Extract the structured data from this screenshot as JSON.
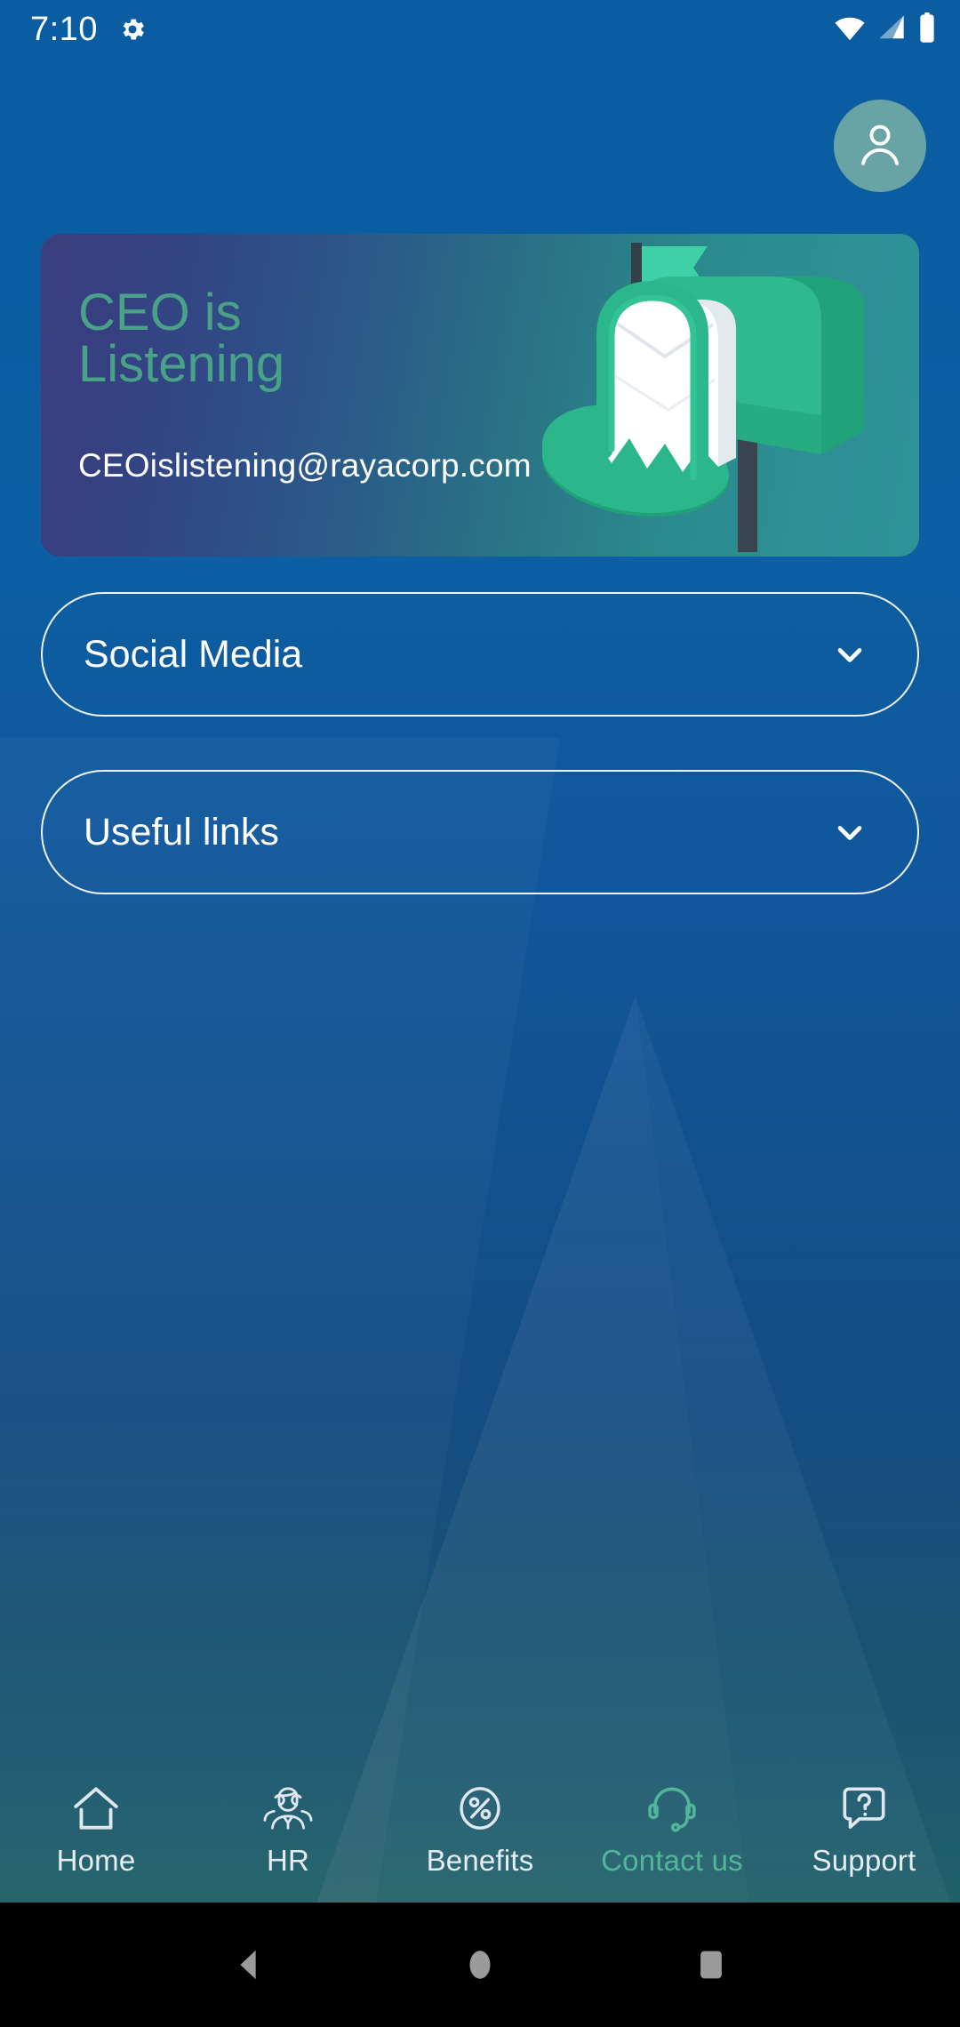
{
  "status_bar": {
    "time": "7:10",
    "gear_icon": "gear-icon",
    "wifi_icon": "wifi-icon",
    "signal_icon": "cellular-signal-icon",
    "battery_icon": "battery-icon"
  },
  "header": {
    "avatar_icon": "user-avatar-icon"
  },
  "ceo_card": {
    "title": "CEO is Listening",
    "email": "CEOislistening@rayacorp.com",
    "illustration": "mailbox-illustration",
    "title_color": "#49a288",
    "gradient_start": "#3b3f7e",
    "gradient_end": "#2f9298"
  },
  "accordions": [
    {
      "label": "Social Media",
      "icon": "chevron-down-icon",
      "expanded": false
    },
    {
      "label": "Useful links",
      "icon": "chevron-down-icon",
      "expanded": false
    }
  ],
  "bottom_nav": {
    "active_color": "#52b79a",
    "inactive_color": "#e6edf4",
    "items": [
      {
        "label": "Home",
        "icon": "home-icon",
        "active": false
      },
      {
        "label": "HR",
        "icon": "people-icon",
        "active": false
      },
      {
        "label": "Benefits",
        "icon": "percent-circle-icon",
        "active": false
      },
      {
        "label": "Contact us",
        "icon": "headset-icon",
        "active": true
      },
      {
        "label": "Support",
        "icon": "question-bubble-icon",
        "active": false
      }
    ]
  },
  "android_nav": {
    "back": "back-triangle-icon",
    "home": "home-circle-icon",
    "recents": "recents-square-icon"
  },
  "theme": {
    "background_top": "#0a5da0",
    "background_bottom": "#206168"
  }
}
